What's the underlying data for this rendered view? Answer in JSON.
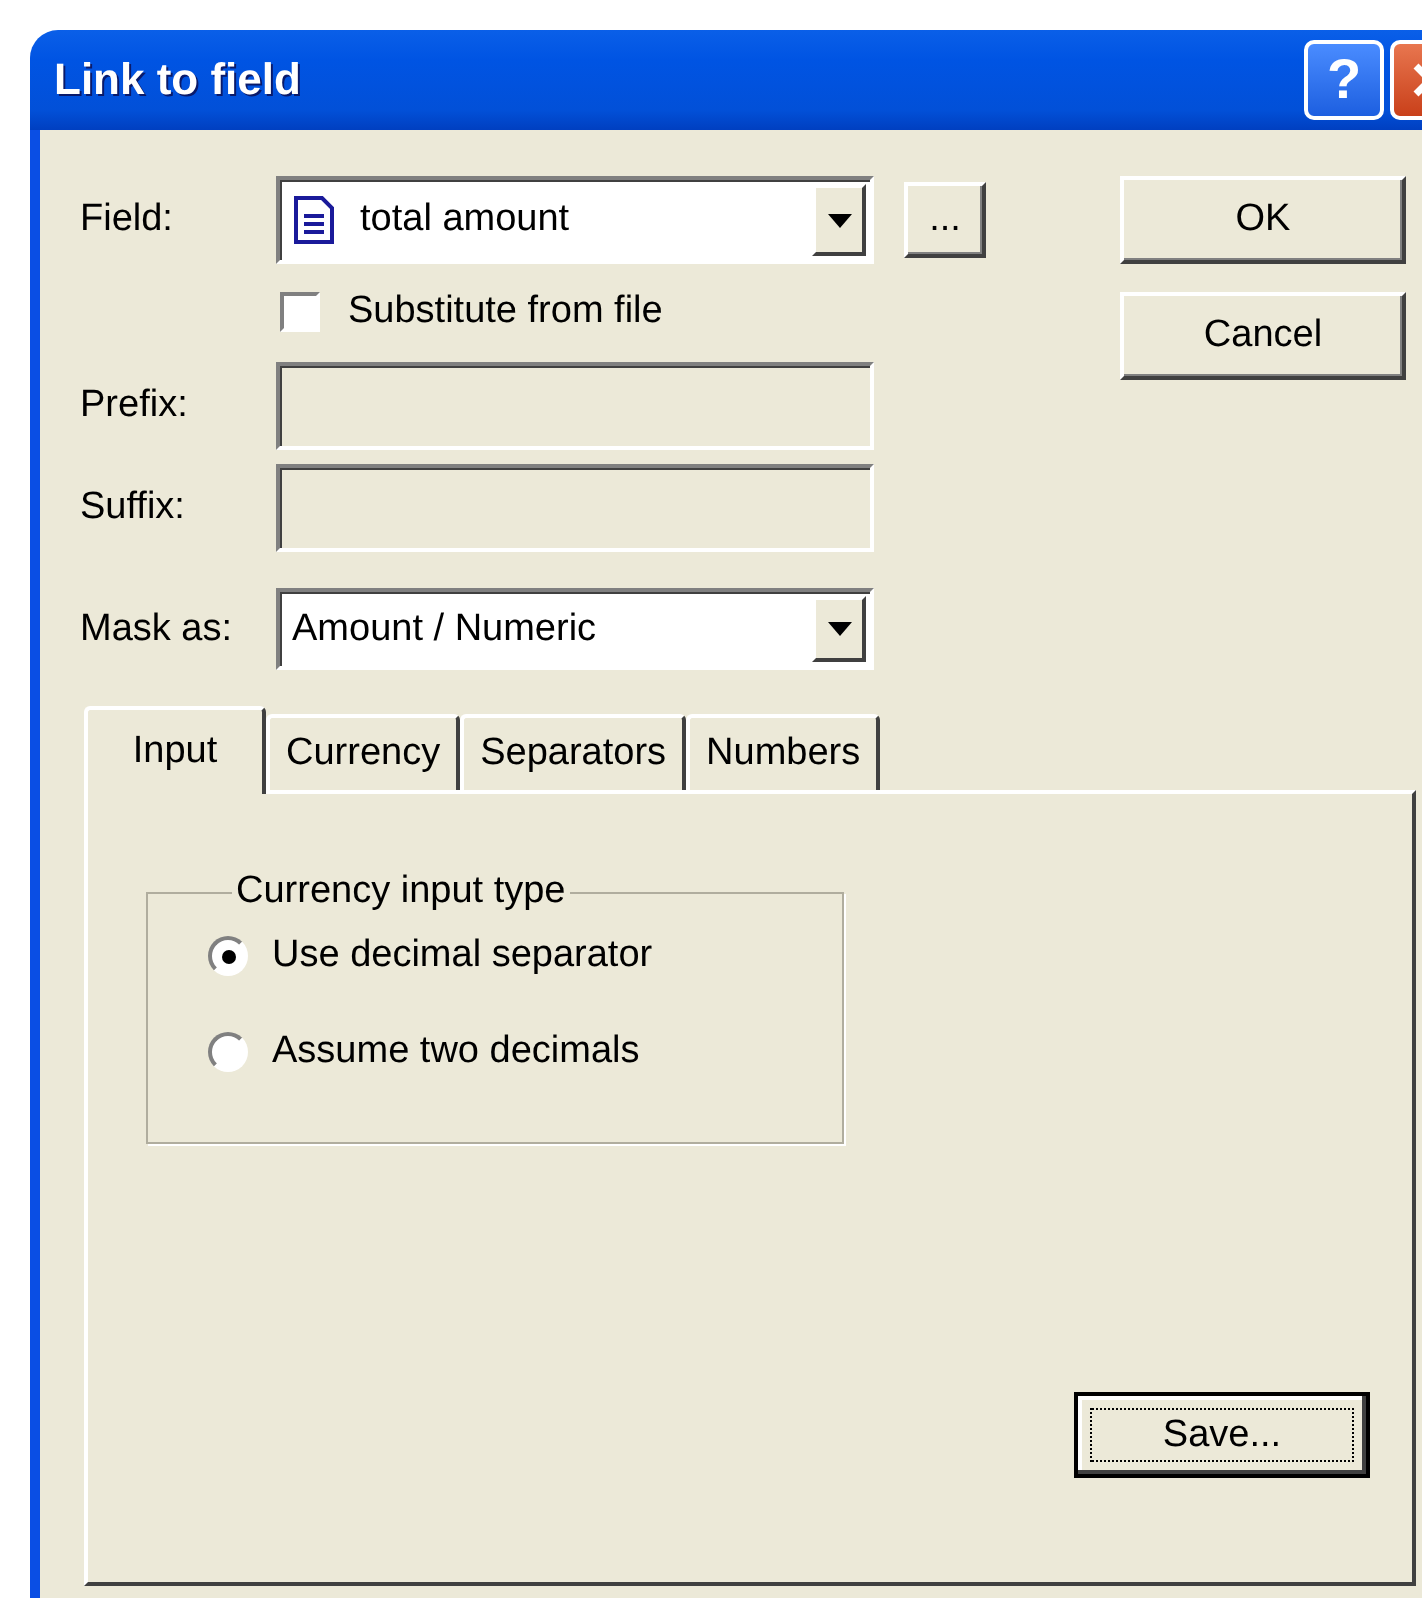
{
  "window": {
    "title": "Link to field",
    "help_button": "?"
  },
  "form": {
    "field": {
      "label": "Field:",
      "value": "total amount",
      "browse_button": "..."
    },
    "substitute": {
      "label": "Substitute from file",
      "checked": false
    },
    "prefix": {
      "label": "Prefix:",
      "disabled": true
    },
    "suffix": {
      "label": "Suffix:",
      "disabled": true
    },
    "mask": {
      "label": "Mask as:",
      "value": "Amount / Numeric"
    }
  },
  "buttons": [
    "OK",
    "Cancel"
  ],
  "tabs": [
    {
      "label": "Input",
      "selected": true
    },
    {
      "label": "Currency",
      "selected": false
    },
    {
      "label": "Separators",
      "selected": false
    },
    {
      "label": "Numbers",
      "selected": false
    }
  ],
  "group": {
    "title": "Currency input type",
    "options": [
      {
        "label": "Use decimal separator",
        "selected": true
      },
      {
        "label": "Assume two decimals",
        "selected": false
      }
    ]
  },
  "save_button": {
    "label": "Save...",
    "focused": true
  }
}
